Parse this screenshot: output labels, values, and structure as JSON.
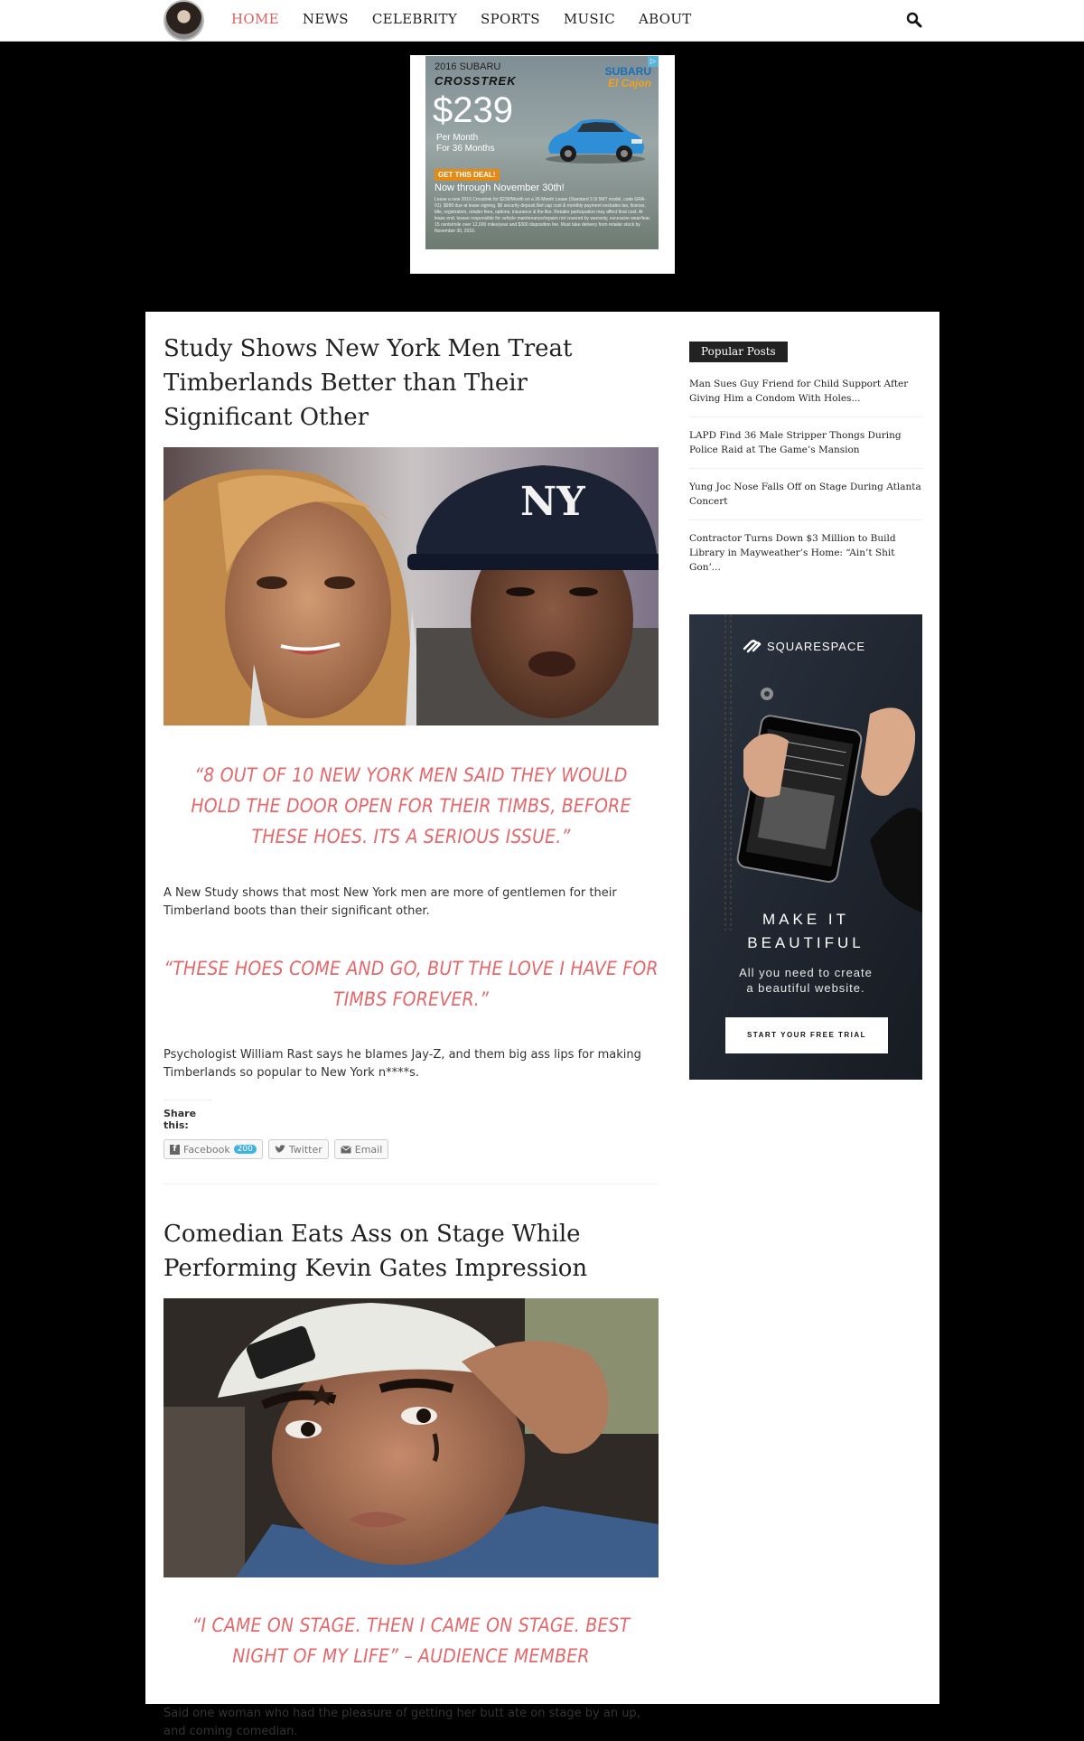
{
  "nav": {
    "items": [
      {
        "label": "HOME",
        "active": true
      },
      {
        "label": "NEWS",
        "active": false
      },
      {
        "label": "CELEBRITY",
        "active": false
      },
      {
        "label": "SPORTS",
        "active": false
      },
      {
        "label": "MUSIC",
        "active": false
      },
      {
        "label": "ABOUT",
        "active": false
      }
    ],
    "search_icon": "search-icon",
    "accent_color": "#e0605d"
  },
  "top_ad": {
    "year_make": "2016 SUBARU",
    "model": "CROSSTREK",
    "brand": "SUBARU",
    "dealer": "El Cajon",
    "price": "$239",
    "per_month": "Per Month",
    "term": "For 36 Months",
    "cta": "GET THIS DEAL!",
    "through": "Now through November 30th!",
    "fine_print": "Lease a new 2016 Crosstrek for $239/Month on a 36-Month Lease (Standard 2.0i 5MT model, code GRA-01). $999 due at lease signing. $0 security deposit.Net cap cost & monthly payment excludes tax, license, title, registration, retailer fees, options, insurance & the like. Retailer participation may affect final cost. At lease end, lessee responsible for vehicle maintenance/repairs not covered by warranty, excessive wear/tear, 15 cents/mile over 12,000 miles/year and $300 disposition fee. Must take delivery from retailer stock by November 30, 2016."
  },
  "posts": [
    {
      "title": "Study Shows New York Men Treat Timberlands Better than Their Significant Other",
      "quote1": "“8 OUT OF 10 NEW YORK MEN SAID THEY WOULD HOLD THE DOOR OPEN FOR THEIR TIMBS, BEFORE THESE HOES. ITS A SERIOUS ISSUE.”",
      "para1": "A New Study shows that most New York men are more of gentlemen for their Timberland boots than their significant other.",
      "quote2": "“THESE HOES COME AND GO, BUT THE LOVE I HAVE FOR TIMBS FOREVER.”",
      "para2": "Psychologist William Rast says he blames Jay-Z, and them big ass lips for making Timberlands so popular to New York n****s.",
      "share_label": "Share this:",
      "share_buttons": [
        {
          "label": "Facebook",
          "count": "200",
          "icon": "facebook-icon"
        },
        {
          "label": "Twitter",
          "icon": "twitter-icon"
        },
        {
          "label": "Email",
          "icon": "email-icon"
        }
      ]
    },
    {
      "title": "Comedian Eats Ass on Stage While Performing Kevin Gates Impression",
      "quote1": "“I CAME ON STAGE. THEN I CAME ON STAGE. BEST NIGHT OF MY LIFE” – AUDIENCE MEMBER",
      "para1": "Said one woman who had the pleasure of getting her butt ate on stage by an up, and coming comedian."
    }
  ],
  "sidebar": {
    "popular_title": "Popular Posts",
    "popular_posts": [
      "Man Sues Guy Friend for Child Support After Giving Him a Condom With Holes...",
      "LAPD Find 36 Male Stripper Thongs During Police Raid at The Game’s Mansion",
      "Yung Joc Nose Falls Off on Stage During Atlanta Concert",
      "Contractor Turns Down $3 Million to Build Library in Mayweather’s Home: “Ain’t Shit Gon’..."
    ],
    "ad": {
      "brand": "SQUARESPACE",
      "headline_1": "MAKE IT",
      "headline_2": "BEAUTIFUL",
      "sub_1": "All you need to create",
      "sub_2": "a beautiful website.",
      "cta": "START YOUR FREE TRIAL"
    }
  }
}
